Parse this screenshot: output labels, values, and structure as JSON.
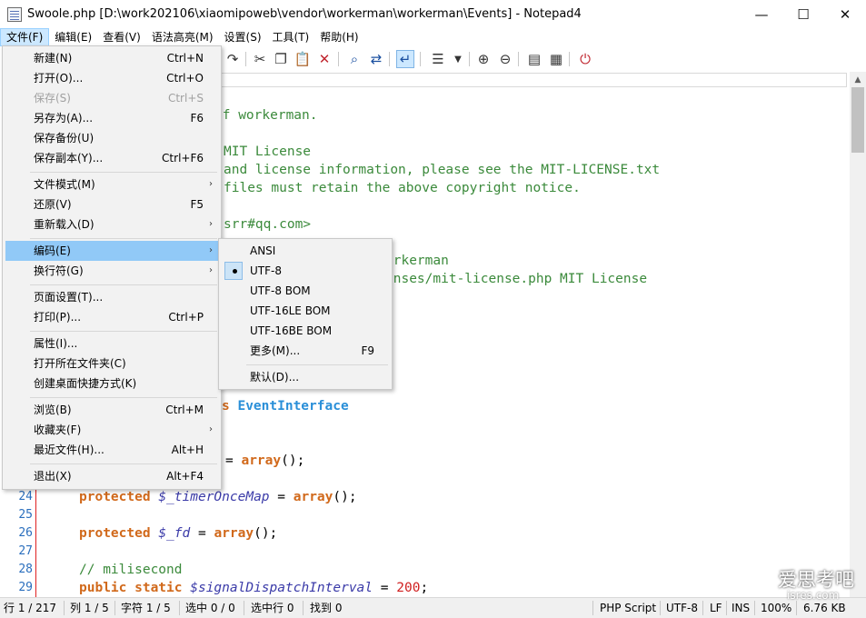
{
  "window": {
    "title": "Swoole.php [D:\\work202106\\xiaomipoweb\\vendor\\workerman\\workerman\\Events] - Notepad4",
    "minimize": "—",
    "maximize": "☐",
    "close": "✕"
  },
  "menubar": {
    "items": [
      "文件(F)",
      "编辑(E)",
      "查看(V)",
      "语法高亮(M)",
      "设置(S)",
      "工具(T)",
      "帮助(H)"
    ]
  },
  "file_menu": {
    "items": [
      {
        "label": "新建(N)",
        "shortcut": "Ctrl+N"
      },
      {
        "label": "打开(O)...",
        "shortcut": "Ctrl+O"
      },
      {
        "label": "保存(S)",
        "shortcut": "Ctrl+S"
      },
      {
        "label": "另存为(A)...",
        "shortcut": "F6"
      },
      {
        "label": "保存备份(U)",
        "shortcut": ""
      },
      {
        "label": "保存副本(Y)...",
        "shortcut": "Ctrl+F6"
      },
      {
        "label": "文件模式(M)",
        "shortcut": ""
      },
      {
        "label": "还原(V)",
        "shortcut": "F5"
      },
      {
        "label": "重新载入(D)",
        "shortcut": ""
      },
      {
        "label": "编码(E)",
        "shortcut": ""
      },
      {
        "label": "换行符(G)",
        "shortcut": ""
      },
      {
        "label": "页面设置(T)...",
        "shortcut": ""
      },
      {
        "label": "打印(P)...",
        "shortcut": "Ctrl+P"
      },
      {
        "label": "属性(I)...",
        "shortcut": ""
      },
      {
        "label": "打开所在文件夹(C)",
        "shortcut": ""
      },
      {
        "label": "创建桌面快捷方式(K)",
        "shortcut": ""
      },
      {
        "label": "浏览(B)",
        "shortcut": "Ctrl+M"
      },
      {
        "label": "收藏夹(F)",
        "shortcut": ""
      },
      {
        "label": "最近文件(H)...",
        "shortcut": "Alt+H"
      },
      {
        "label": "退出(X)",
        "shortcut": "Alt+F4"
      }
    ]
  },
  "encoding_menu": {
    "items": [
      {
        "label": "ANSI",
        "shortcut": ""
      },
      {
        "label": "UTF-8",
        "shortcut": ""
      },
      {
        "label": "UTF-8 BOM",
        "shortcut": ""
      },
      {
        "label": "UTF-16LE BOM",
        "shortcut": ""
      },
      {
        "label": "UTF-16BE BOM",
        "shortcut": ""
      },
      {
        "label": "更多(M)...",
        "shortcut": "F9"
      },
      {
        "label": "默认(D)...",
        "shortcut": ""
      }
    ],
    "selected": "UTF-8"
  },
  "editor": {
    "visible_fragments": {
      "l1": "of workerman.",
      "l3": "MIT License",
      "l4": "and license information, please see the MIT-LICENSE.txt",
      "l5": "files must retain the above copyright notice.",
      "l7": "srr#qq.com>",
      "l9": "orkerman",
      "l10": "enses/mit-license.php MIT License",
      "l17a": "s",
      "l17b": "EventInterface",
      "l20a": "=",
      "l20b": "array",
      "l20c": "();"
    },
    "lines": [
      {
        "num": "24",
        "kw": "protected",
        "var": "$_timerOnceMap",
        "rest": " = ",
        "fn": "array",
        "tail": "();"
      },
      {
        "num": "25"
      },
      {
        "num": "26",
        "kw": "protected",
        "var": "$_fd",
        "rest": " = ",
        "fn": "array",
        "tail": "();"
      },
      {
        "num": "27"
      },
      {
        "num": "28",
        "comment": "// milisecond"
      },
      {
        "num": "29",
        "kw": "public static",
        "var": "$signalDispatchInterval",
        "rest": " = ",
        "number": "200",
        "tail": ";"
      }
    ]
  },
  "statusbar": {
    "line": "行 1 / 217",
    "col": "列 1 / 5",
    "char": "字符 1 / 5",
    "sel": "选中 0 / 0",
    "sel_lines": "选中行 0",
    "found": "找到 0",
    "lang": "PHP Script",
    "encoding": "UTF-8",
    "eol": "LF",
    "ins": "INS",
    "zoom": "100%",
    "size": "6.76 KB"
  },
  "watermark": {
    "text": "爱思考吧",
    "sub": "isres.com"
  }
}
